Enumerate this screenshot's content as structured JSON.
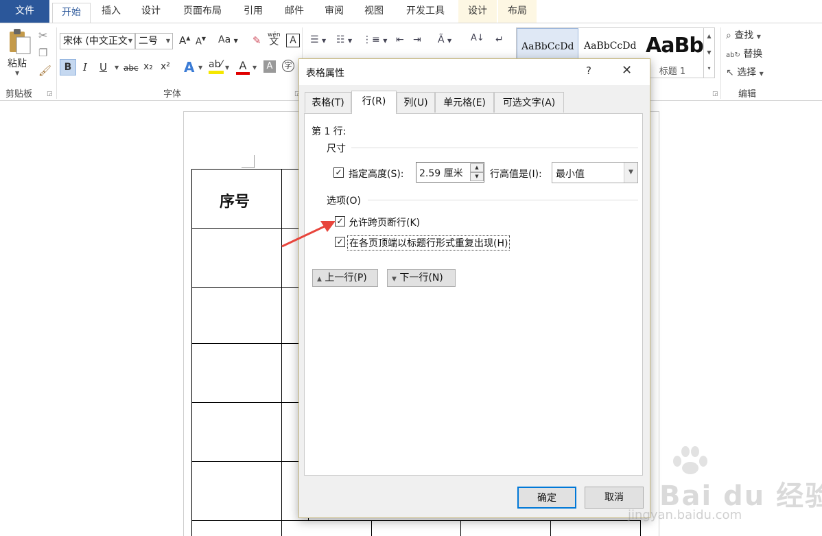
{
  "ribbon": {
    "tabs": [
      {
        "label": "文件"
      },
      {
        "label": "开始"
      },
      {
        "label": "插入"
      },
      {
        "label": "设计"
      },
      {
        "label": "页面布局"
      },
      {
        "label": "引用"
      },
      {
        "label": "邮件"
      },
      {
        "label": "审阅"
      },
      {
        "label": "视图"
      },
      {
        "label": "开发工具"
      },
      {
        "label": "设计"
      },
      {
        "label": "布局"
      }
    ],
    "active_tab": "开始",
    "clipboard": {
      "paste_label": "粘贴",
      "group_label": "剪贴板"
    },
    "font": {
      "font_name": "宋体 (中文正文",
      "font_size": "二号",
      "group_label": "字体",
      "bold": "B",
      "italic": "I",
      "underline": "U",
      "strike": "abc",
      "subscript": "x₂",
      "superscript": "x²",
      "phonetic": "wén"
    },
    "styles": {
      "items": [
        {
          "preview": "AaBbCcDd",
          "name": ""
        },
        {
          "preview": "AaBbCcDd",
          "name": ""
        },
        {
          "preview": "AaBb",
          "name": "标题 1"
        }
      ]
    },
    "editing": {
      "find": "查找",
      "replace": "替换",
      "select": "选择",
      "group_label": "编辑"
    }
  },
  "document": {
    "header_cell": "序号"
  },
  "dialog": {
    "title": "表格属性",
    "help": "?",
    "close": "✕",
    "tabs": [
      {
        "label": "表格(T)"
      },
      {
        "label": "行(R)"
      },
      {
        "label": "列(U)"
      },
      {
        "label": "单元格(E)"
      },
      {
        "label": "可选文字(A)"
      }
    ],
    "active_tab": "行(R)",
    "row_heading": "第 1 行:",
    "size_section": "尺寸",
    "specify_height": {
      "label": "指定高度(S):",
      "checked": true
    },
    "height_value": "2.59 厘米",
    "row_height_is": {
      "label": "行高值是(I):",
      "value": "最小值"
    },
    "options_section": "选项(O)",
    "allow_break": {
      "label": "允许跨页断行(K)",
      "checked": true
    },
    "repeat_header": {
      "label": "在各页顶端以标题行形式重复出现(H)",
      "checked": true
    },
    "prev_row": "上一行(P)",
    "next_row": "下一行(N)",
    "ok": "确定",
    "cancel": "取消"
  },
  "watermark": {
    "brand": "Bai du 经验",
    "url": "jingyan.baidu.com"
  },
  "colors": {
    "ribbon_file": "#2b579a",
    "accent": "#0078d7",
    "arrow": "#e8453c"
  }
}
